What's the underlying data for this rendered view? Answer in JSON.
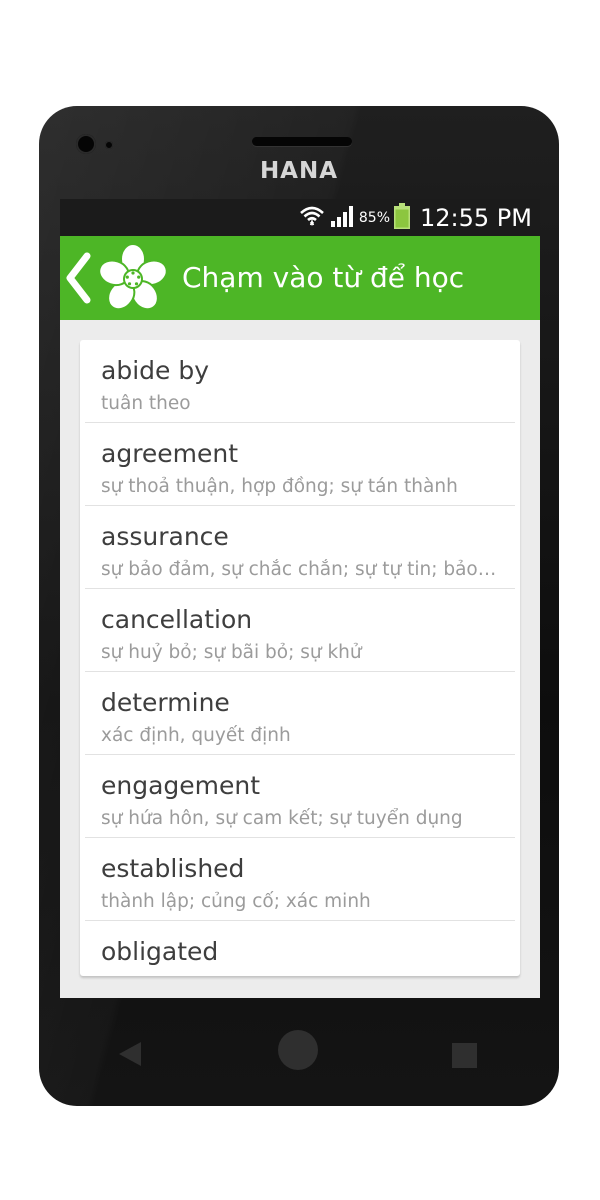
{
  "device": {
    "brand": "HANA"
  },
  "status_bar": {
    "battery_percent": "85%",
    "time": "12:55 PM",
    "battery_level": 0.85
  },
  "app_bar": {
    "title": "Chạm vào từ để học",
    "back_icon": "chevron-left-icon",
    "app_icon": "flower-icon"
  },
  "words": [
    {
      "word": "abide by",
      "meaning": "tuân theo"
    },
    {
      "word": "agreement",
      "meaning": "sự thoả thuận, hợp đồng; sự tán thành"
    },
    {
      "word": "assurance",
      "meaning": "sự bảo đảm, sự chắc chắn; sự tự tin; bảo hiểm"
    },
    {
      "word": "cancellation",
      "meaning": "sự huỷ bỏ;  sự bãi bỏ; sự khử"
    },
    {
      "word": "determine",
      "meaning": "xác định, quyết định"
    },
    {
      "word": "engagement",
      "meaning": "sự hứa hôn, sự cam kết; sự tuyển dụng"
    },
    {
      "word": "established",
      "meaning": "thành lập; củng cố; xác minh"
    },
    {
      "word": "obligated",
      "meaning": ""
    }
  ],
  "colors": {
    "accent": "#4db626",
    "status_bar": "#1b1b1b",
    "background": "#ececec"
  }
}
